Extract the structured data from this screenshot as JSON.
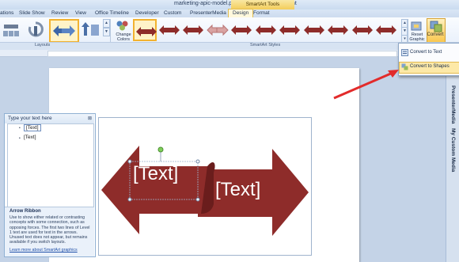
{
  "window": {
    "title": "marketing-apic-model.pptx - Microsoft PowerPoint",
    "contextual_tab_group": "SmartArt Tools"
  },
  "tabs": [
    {
      "label": "ations"
    },
    {
      "label": "Slide Show"
    },
    {
      "label": "Review"
    },
    {
      "label": "View"
    },
    {
      "label": "Office Timeline"
    },
    {
      "label": "Developer"
    },
    {
      "label": "Custom"
    },
    {
      "label": "PresenterMedia"
    },
    {
      "label": "Design",
      "active": true
    },
    {
      "label": "Format"
    }
  ],
  "ribbon": {
    "groups": {
      "layouts": "Layouts",
      "smartart_styles": "SmartArt Styles"
    },
    "change_colors_label": "Change Colors",
    "reset_graphic_label": "Reset Graphic",
    "convert_label": "Convert",
    "style_count": 11
  },
  "convert_menu": {
    "items": [
      {
        "label": "Convert to Text",
        "icon": "convert-to-text-icon"
      },
      {
        "label": "Convert to Shapes",
        "icon": "convert-to-shapes-icon"
      }
    ]
  },
  "side_panel": {
    "items": [
      {
        "label": "PresenterMedia"
      },
      {
        "label": "My Custom Media"
      }
    ]
  },
  "text_pane": {
    "title": "Type your text here",
    "close_glyph": "⊠",
    "items": [
      {
        "text": "[Text]"
      },
      {
        "text": "[Text]"
      }
    ],
    "layout_name": "Arrow Ribbon",
    "description": "Use to show either related or contrasting concepts with some connection, such as opposing forces. The first two lines of Level 1 text are used for text in the arrows. Unused text does not appear, but remains available if you switch layouts.",
    "learn_more": "Learn more about SmartArt graphics"
  },
  "smartart": {
    "left_text": "[Text]",
    "right_text": "[Text]",
    "arrow_color": "#8e2c2a",
    "shadow_color": "#6a1d1c"
  },
  "colors": {
    "accent": "#8e2c2a",
    "ribbon_bg": "#e5eefa",
    "contextual": "#f3cd5a",
    "annotation_arrow": "#e22b2b"
  }
}
